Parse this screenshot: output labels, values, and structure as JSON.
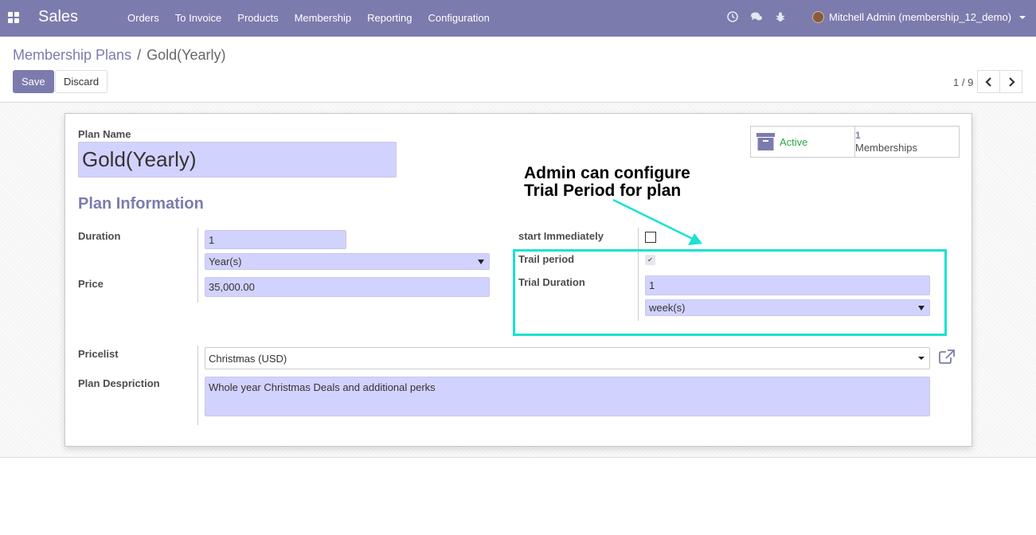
{
  "app": {
    "name": "Sales"
  },
  "nav": {
    "menu": [
      {
        "label": "Orders"
      },
      {
        "label": "To Invoice"
      },
      {
        "label": "Products"
      },
      {
        "label": "Membership"
      },
      {
        "label": "Reporting"
      },
      {
        "label": "Configuration"
      }
    ],
    "icons": [
      "clock-icon",
      "chat-icon",
      "bug-icon"
    ],
    "user": "Mitchell Admin (membership_12_demo)"
  },
  "breadcrumb": {
    "parent": "Membership Plans",
    "separator": "/",
    "current": "Gold(Yearly)"
  },
  "actions": {
    "save": "Save",
    "discard": "Discard"
  },
  "pager": {
    "value": "1 / 9"
  },
  "form": {
    "plan_name_label": "Plan Name",
    "plan_name": "Gold(Yearly)",
    "stat_active_label": "Active",
    "stat_memberships_count": "1",
    "stat_memberships_label": "Memberships",
    "section_title": "Plan Information",
    "duration_label": "Duration",
    "duration_value": "1",
    "duration_unit": "Year(s)",
    "price_label": "Price",
    "price_value": "35,000.00",
    "start_immediately_label": "start Immediately",
    "start_immediately": false,
    "trail_period_label": "Trail period",
    "trail_period": true,
    "trial_duration_label": "Trial Duration",
    "trial_duration_value": "1",
    "trial_duration_unit": "week(s)",
    "pricelist_label": "Pricelist",
    "pricelist_value": "Christmas (USD)",
    "description_label": "Plan Despriction",
    "description_value": "Whole year Christmas Deals and additional perks"
  },
  "annotation": {
    "line1": "Admin can configure",
    "line2": "Trial Period for plan",
    "color": "#19e2d3"
  },
  "colors": {
    "brand": "#7c7bad",
    "input_bg": "#d2d2ff",
    "active_green": "#28a745"
  }
}
